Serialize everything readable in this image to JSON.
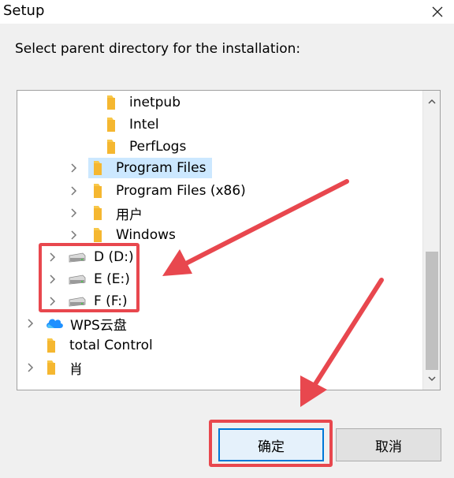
{
  "window": {
    "title": "Setup",
    "close_icon": "close-icon"
  },
  "prompt": "Select parent directory for the installation:",
  "tree": {
    "items": [
      {
        "label": "inetpub",
        "icon": "folder-icon",
        "expandable": false
      },
      {
        "label": "Intel",
        "icon": "folder-icon",
        "expandable": false
      },
      {
        "label": "PerfLogs",
        "icon": "folder-icon",
        "expandable": false
      },
      {
        "label": "Program Files",
        "icon": "folder-icon",
        "expandable": true,
        "selected": true
      },
      {
        "label": "Program Files (x86)",
        "icon": "folder-icon",
        "expandable": true
      },
      {
        "label": "用户",
        "icon": "folder-icon",
        "expandable": true
      },
      {
        "label": "Windows",
        "icon": "folder-icon",
        "expandable": true
      },
      {
        "label": "D (D:)",
        "icon": "drive-icon",
        "expandable": true
      },
      {
        "label": "E (E:)",
        "icon": "drive-icon",
        "expandable": true
      },
      {
        "label": "F (F:)",
        "icon": "drive-icon",
        "expandable": true
      },
      {
        "label": "WPS云盘",
        "icon": "cloud-icon",
        "expandable": true
      },
      {
        "label": "total Control",
        "icon": "folder-icon",
        "expandable": false
      },
      {
        "label": "肖",
        "icon": "folder-icon",
        "expandable": true
      }
    ]
  },
  "buttons": {
    "ok_label": "确定",
    "cancel_label": "取消"
  },
  "colors": {
    "accent": "#0078d7",
    "selection": "#cce8ff",
    "annotation": "#e8474e",
    "folder": "#f8c84a"
  }
}
